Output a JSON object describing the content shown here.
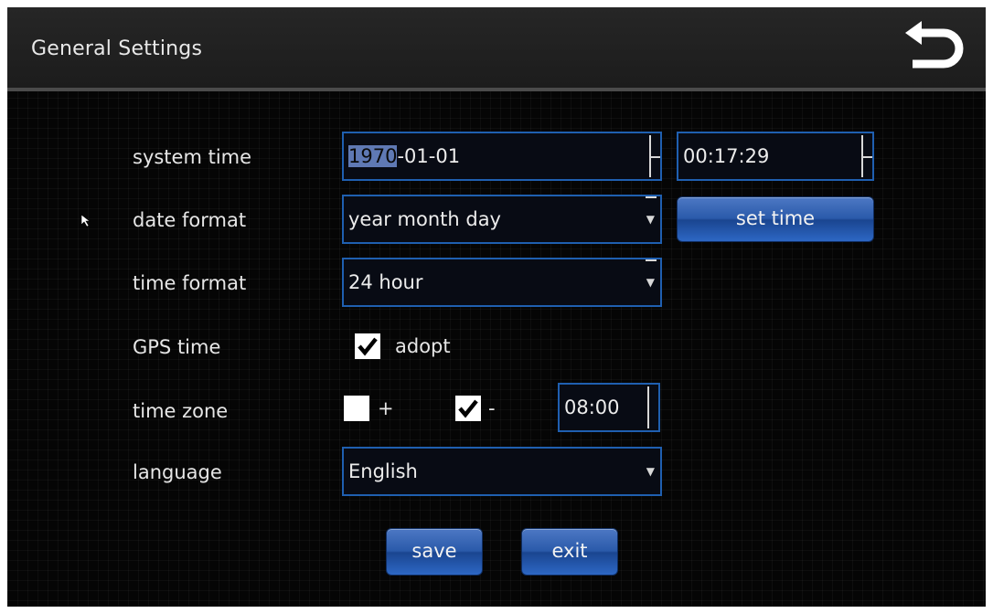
{
  "header": {
    "title": "General Settings",
    "back_icon": "undo-arrow-icon"
  },
  "system_time": {
    "label": "system time",
    "date_value_selected": "1970",
    "date_value_rest": "-01-01",
    "time_value": "00:17:29"
  },
  "date_format": {
    "label": "date format",
    "value": "year month day",
    "set_time_label": "set time"
  },
  "time_format": {
    "label": "time format",
    "value": "24 hour"
  },
  "gps_time": {
    "label": "GPS time",
    "option_label": "adopt",
    "checked": true
  },
  "time_zone": {
    "label": "time zone",
    "plus_label": "+",
    "plus_checked": false,
    "minus_label": "-",
    "minus_checked": true,
    "offset_value": "08:00"
  },
  "language": {
    "label": "language",
    "value": "English"
  },
  "actions": {
    "save_label": "save",
    "exit_label": "exit"
  },
  "colors": {
    "accent": "#1f5fb0",
    "button": "#2a5aaa",
    "background": "#050505"
  }
}
